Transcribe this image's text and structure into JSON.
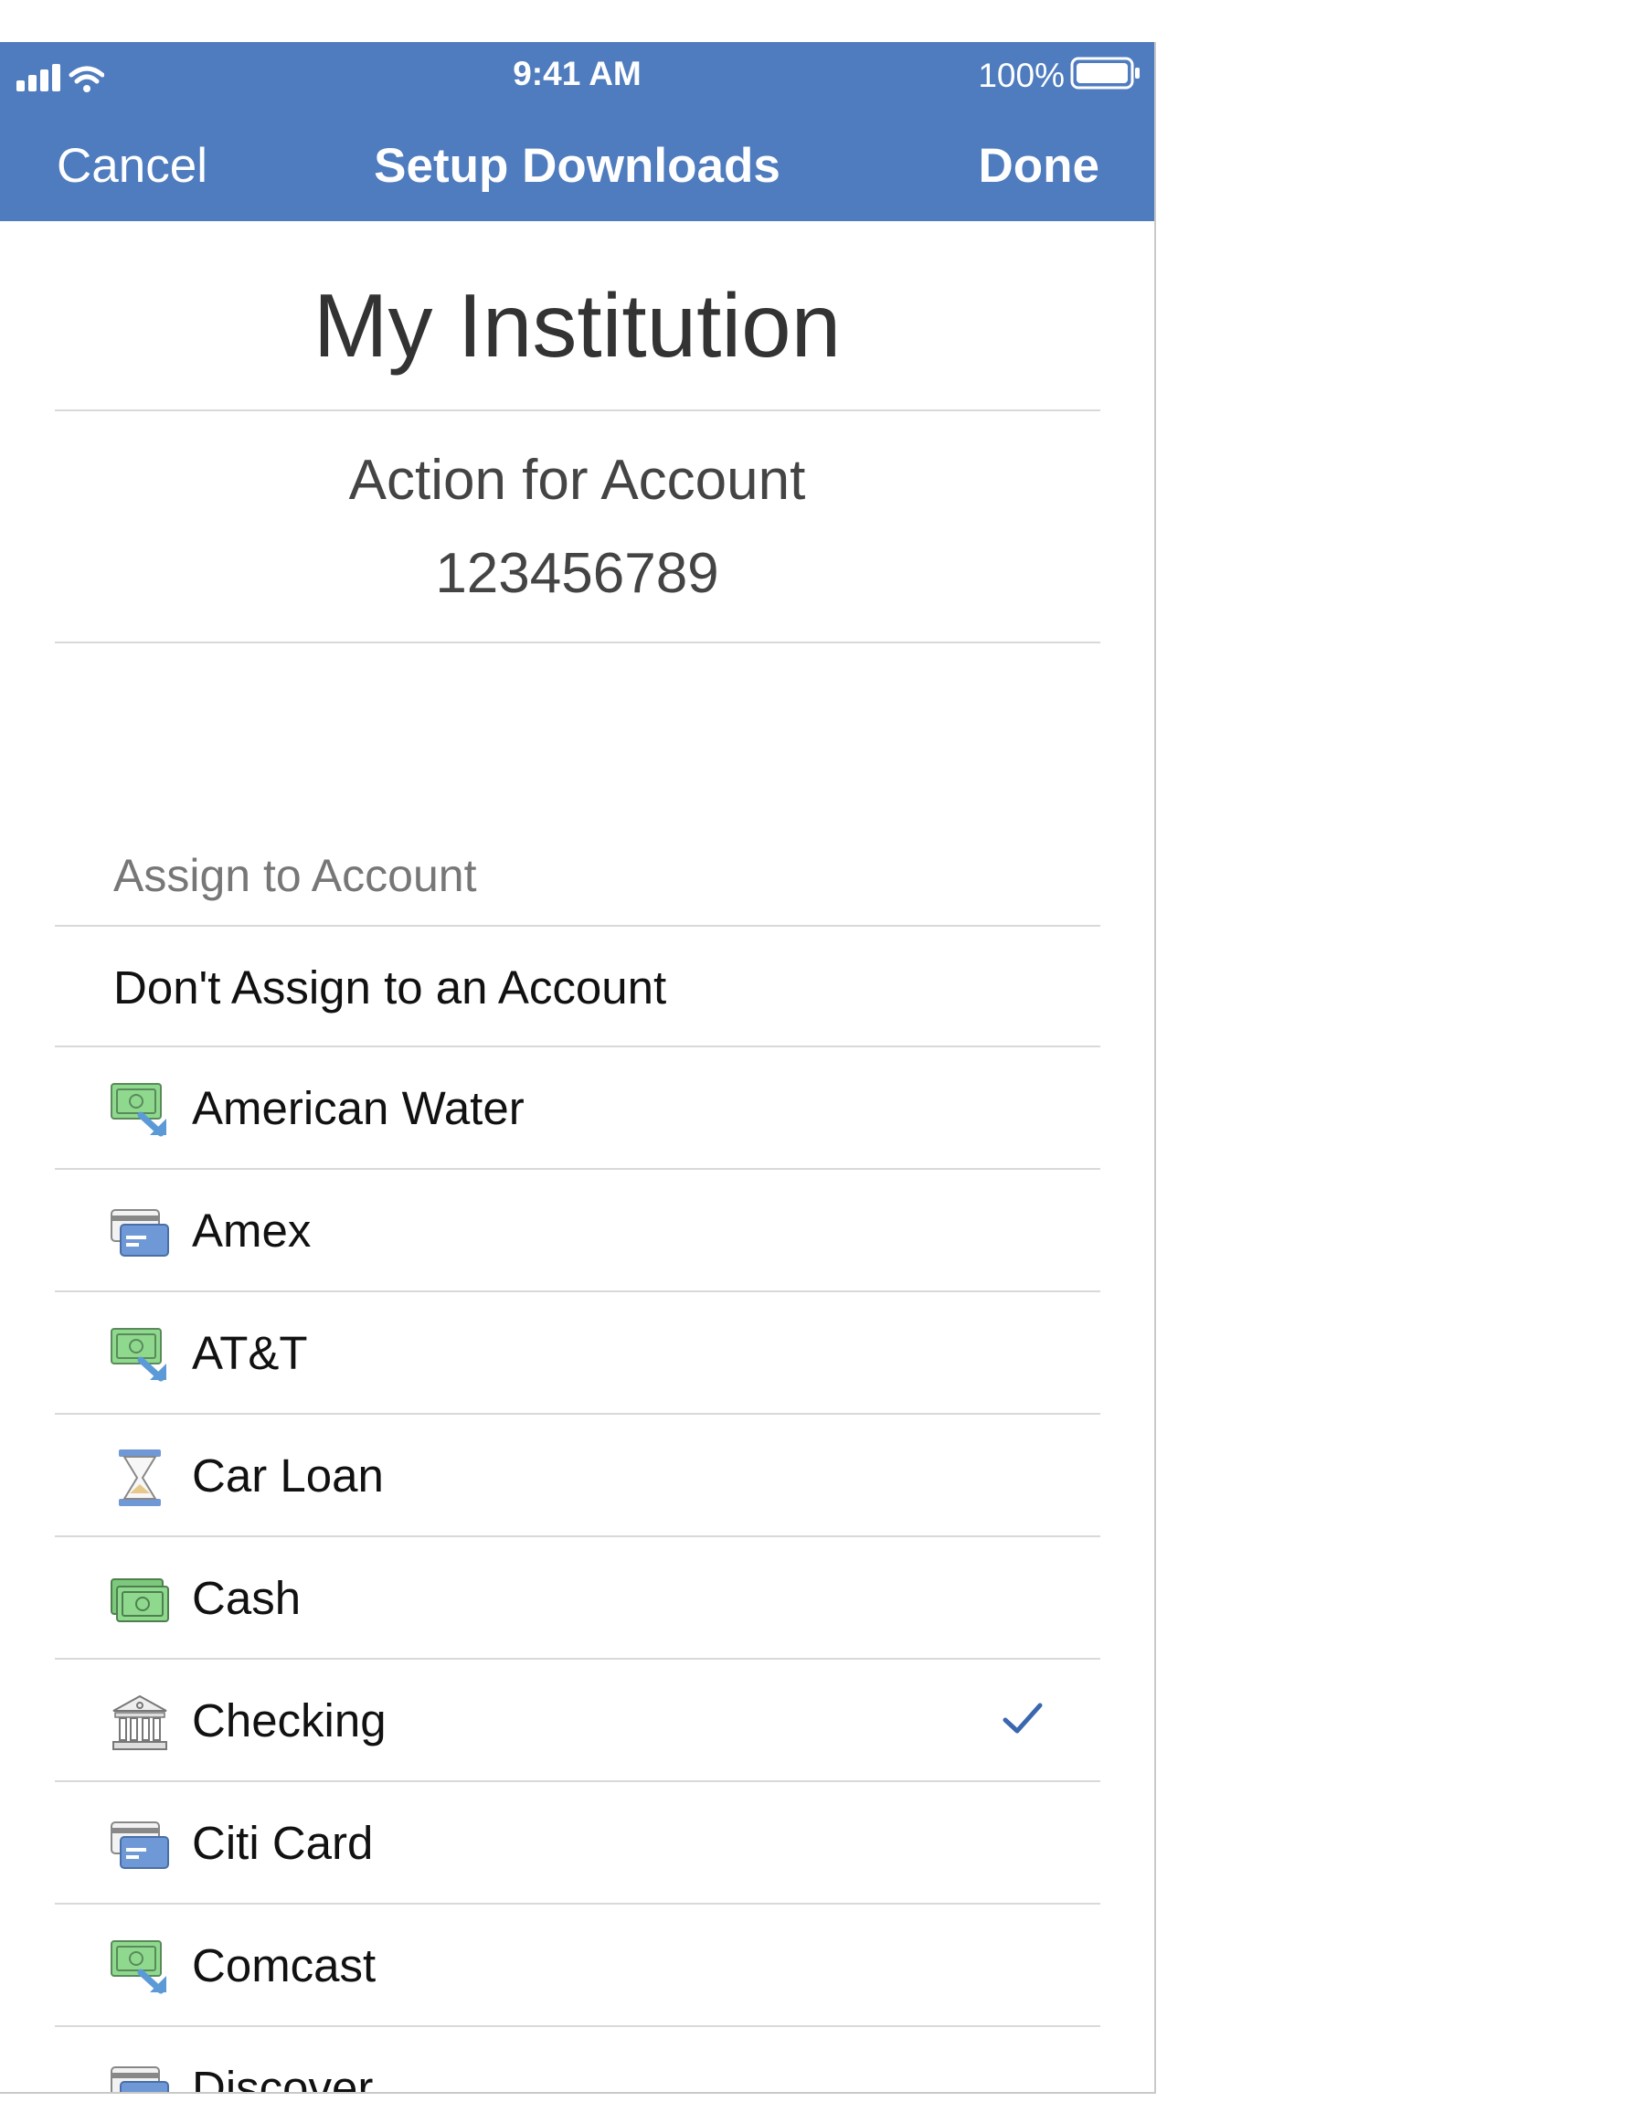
{
  "status_bar": {
    "time": "9:41 AM",
    "battery_percent": "100%",
    "signal_icon": "cellular-signal-icon",
    "wifi_icon": "wifi-icon",
    "battery_icon": "battery-icon"
  },
  "nav": {
    "cancel_label": "Cancel",
    "title": "Setup Downloads",
    "done_label": "Done",
    "background_color": "#4F7CBE"
  },
  "institution": {
    "name": "My Institution",
    "action_label": "Action for Account",
    "account_number": "123456789"
  },
  "assign_section": {
    "header": "Assign to Account",
    "none_option": "Don't Assign to an Account",
    "accounts": [
      {
        "label": "American Water",
        "icon": "bill-icon"
      },
      {
        "label": "Amex",
        "icon": "credit-card-icon"
      },
      {
        "label": "AT&T",
        "icon": "bill-icon"
      },
      {
        "label": "Car Loan",
        "icon": "hourglass-icon"
      },
      {
        "label": "Cash",
        "icon": "cash-icon"
      },
      {
        "label": "Checking",
        "icon": "bank-icon",
        "selected": true
      },
      {
        "label": "Citi Card",
        "icon": "credit-card-icon"
      },
      {
        "label": "Comcast",
        "icon": "bill-icon"
      },
      {
        "label": "Discover",
        "icon": "credit-card-icon"
      }
    ],
    "check_color": "#3A67B0"
  }
}
